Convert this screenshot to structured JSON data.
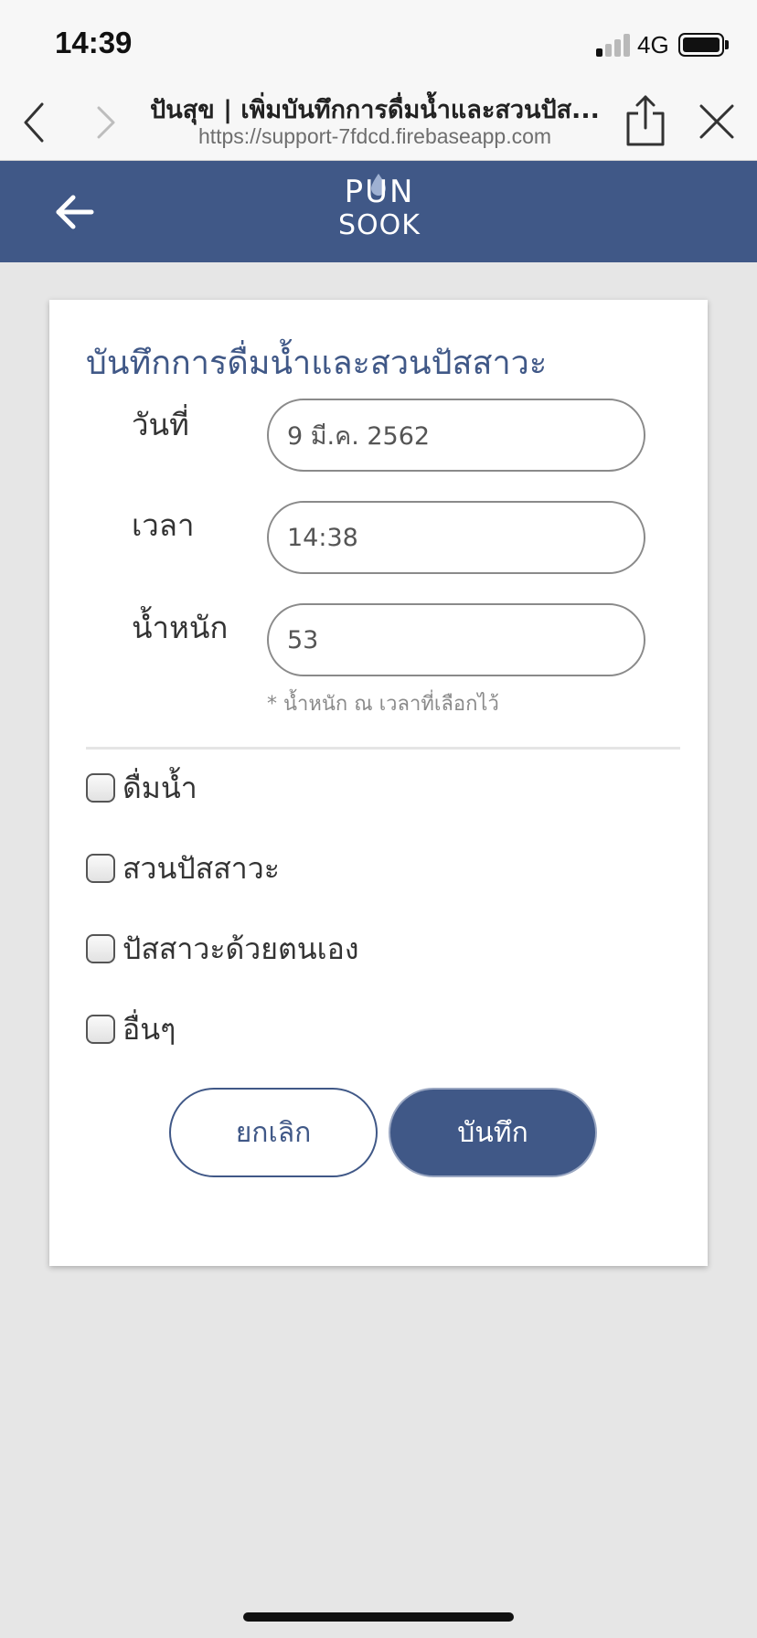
{
  "status_bar": {
    "time": "14:39",
    "network": "4G",
    "signal_bars_active": 1,
    "signal_bars_total": 4,
    "battery_level": 1.0
  },
  "browser": {
    "page_title": "ปันสุข | เพิ่มบันทึกการดื่มน้ำและสวนปัส...",
    "url": "https://support-7fdcd.firebaseapp.com",
    "icons": {
      "back": "chevron-left-icon",
      "forward": "chevron-right-icon",
      "share": "share-icon",
      "close": "close-icon"
    }
  },
  "app_header": {
    "back_icon": "arrow-left-icon",
    "logo_top": "PUN",
    "logo_bottom": "SOOK",
    "brand_color": "#405887"
  },
  "form": {
    "title": "บันทึกการดื่มน้ำและสวนปัสสาวะ",
    "fields": [
      {
        "label": "วันที่",
        "value": "9 มี.ค. 2562"
      },
      {
        "label": "เวลา",
        "value": "14:38"
      },
      {
        "label": "น้ำหนัก",
        "value": "53"
      }
    ],
    "weight_note": "* น้ำหนัก ณ เวลาที่เลือกไว้",
    "checkboxes": [
      {
        "label": "ดื่มน้ำ",
        "checked": false
      },
      {
        "label": "สวนปัสสาวะ",
        "checked": false
      },
      {
        "label": "ปัสสาวะด้วยตนเอง",
        "checked": false
      },
      {
        "label": "อื่นๆ",
        "checked": false
      }
    ],
    "cancel_label": "ยกเลิก",
    "save_label": "บันทึก"
  }
}
